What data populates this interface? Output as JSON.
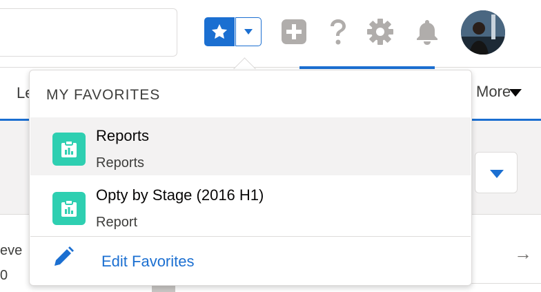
{
  "header": {
    "search": {
      "placeholder": ""
    }
  },
  "nav": {
    "left_fragment": "Le",
    "more_label": "More"
  },
  "rows": {
    "left_fragment": "eve",
    "left_fragment2": "0",
    "arrow": "→"
  },
  "favorites": {
    "heading": "MY FAVORITES",
    "items": [
      {
        "title": "Reports",
        "subtitle": "Reports",
        "icon": "report-icon"
      },
      {
        "title": "Opty by Stage (2016 H1)",
        "subtitle": "Report",
        "icon": "report-icon"
      }
    ],
    "edit_label": "Edit Favorites"
  },
  "colors": {
    "brand_blue": "#1b6fd1",
    "report_teal": "#2ecfb1",
    "icon_gray": "#b0adab"
  }
}
